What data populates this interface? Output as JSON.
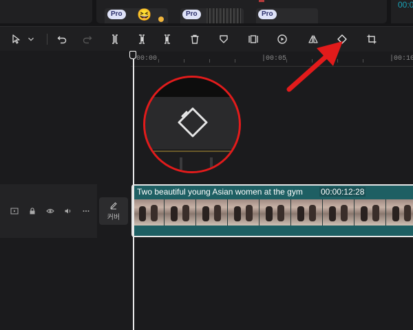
{
  "media": {
    "pro_badges": [
      "Pro",
      "Pro",
      "Pro"
    ],
    "emoji": "😆",
    "corner_text": "00:0"
  },
  "toolbar": {
    "icons": [
      "select-cursor-icon",
      "dropdown-chevron-icon",
      "undo-icon",
      "redo-icon",
      "split-icon",
      "delete-left-icon",
      "delete-right-icon",
      "delete-icon",
      "mask-icon",
      "freeze-frame-icon",
      "speed-icon",
      "mirror-icon",
      "rotate-icon",
      "crop-icon"
    ]
  },
  "timeline": {
    "ruler_labels": [
      "00:00",
      "|00:05",
      "|00:10"
    ]
  },
  "track": {
    "cover_label": "커버"
  },
  "clip": {
    "title": "Two beautiful young Asian women at the gym",
    "duration": "00:00:12:28"
  },
  "colors": {
    "accent": "#19a3b8",
    "clip_bg": "#1e5f63",
    "highlight": "#e21b1b"
  }
}
